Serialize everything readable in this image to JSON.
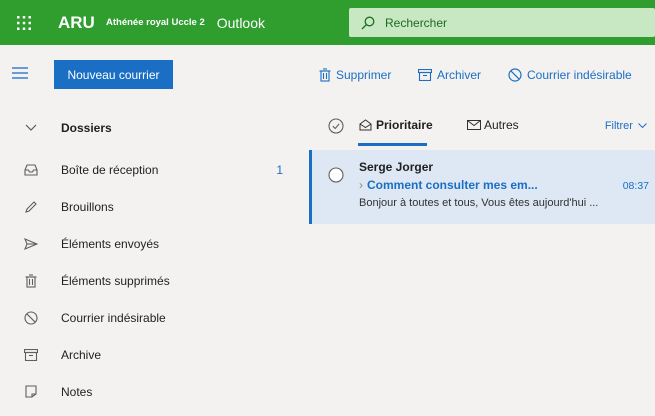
{
  "header": {
    "logo_text": "ARU",
    "school_name": "Athénée royal Uccle 2",
    "app_name": "Outlook",
    "search_placeholder": "Rechercher",
    "icons": {
      "waffle": "app-launcher-icon",
      "search": "search-icon"
    }
  },
  "toolbar": {
    "new_mail_label": "Nouveau courrier",
    "delete_label": "Supprimer",
    "archive_label": "Archiver",
    "junk_label": "Courrier indésirable"
  },
  "nav": {
    "header_label": "Dossiers",
    "items": [
      {
        "label": "Boîte de réception",
        "count": "1",
        "icon": "inbox-icon"
      },
      {
        "label": "Brouillons",
        "count": "",
        "icon": "pencil-icon"
      },
      {
        "label": "Éléments envoyés",
        "count": "",
        "icon": "send-icon"
      },
      {
        "label": "Éléments supprimés",
        "count": "",
        "icon": "trash-icon"
      },
      {
        "label": "Courrier indésirable",
        "count": "",
        "icon": "block-icon"
      },
      {
        "label": "Archive",
        "count": "",
        "icon": "archive-icon"
      },
      {
        "label": "Notes",
        "count": "",
        "icon": "note-icon"
      }
    ]
  },
  "list": {
    "tab_focused": "Prioritaire",
    "tab_other": "Autres",
    "filter_label": "Filtrer",
    "messages": [
      {
        "sender": "Serge Jorger",
        "subject": "Comment consulter mes em...",
        "time": "08:37",
        "preview": "Bonjour à toutes et tous, Vous êtes aujourd'hui ..."
      }
    ]
  },
  "colors": {
    "header_green": "#2f9e2f",
    "accent_blue": "#1a6fc4",
    "pane_bg": "#f3f2f1",
    "selected_bg": "#dde8f4"
  }
}
